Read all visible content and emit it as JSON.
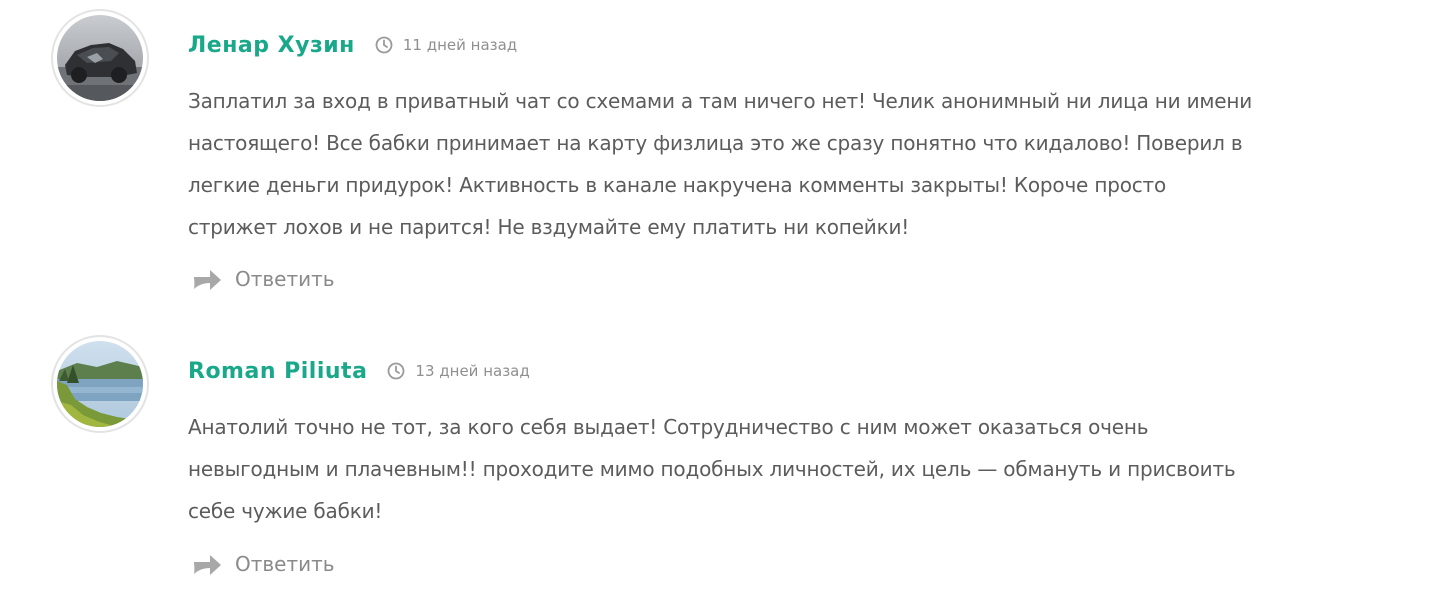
{
  "colors": {
    "author": "#1aa88a",
    "text": "#5c5c5c",
    "meta": "#8f8f8f",
    "reply_icon": "#9a9a9a"
  },
  "comments": [
    {
      "avatar_icon": "avatar-photo-vehicle",
      "author": "Ленар Хузин",
      "date_icon": "clock-icon",
      "date": "11 дней назад",
      "lines": [
        "Заплатил за вход в приватный чат со схемами а там ничего нет! Челик анонимный ни лица ни имени",
        "настоящего! Все бабки принимает на карту физлица это же сразу понятно что кидалово! Поверил в",
        "легкие деньги придурок! Активность в канале накручена комменты закрыты! Короче просто",
        "стрижет лохов и не парится! Не вздумайте ему платить ни копейки!"
      ],
      "reply_icon": "reply-arrow-icon",
      "reply_label": "Ответить"
    },
    {
      "avatar_icon": "avatar-photo-lake",
      "author": "Roman Piliuta",
      "date_icon": "clock-icon",
      "date": "13 дней назад",
      "lines": [
        "Анатолий точно не тот, за кого себя выдает! Сотрудничество с ним может оказаться очень",
        "невыгодным и плачевным!! проходите мимо подобных личностей, их цель — обмануть и присвоить",
        "себе чужие бабки!"
      ],
      "reply_icon": "reply-arrow-icon",
      "reply_label": "Ответить"
    }
  ]
}
